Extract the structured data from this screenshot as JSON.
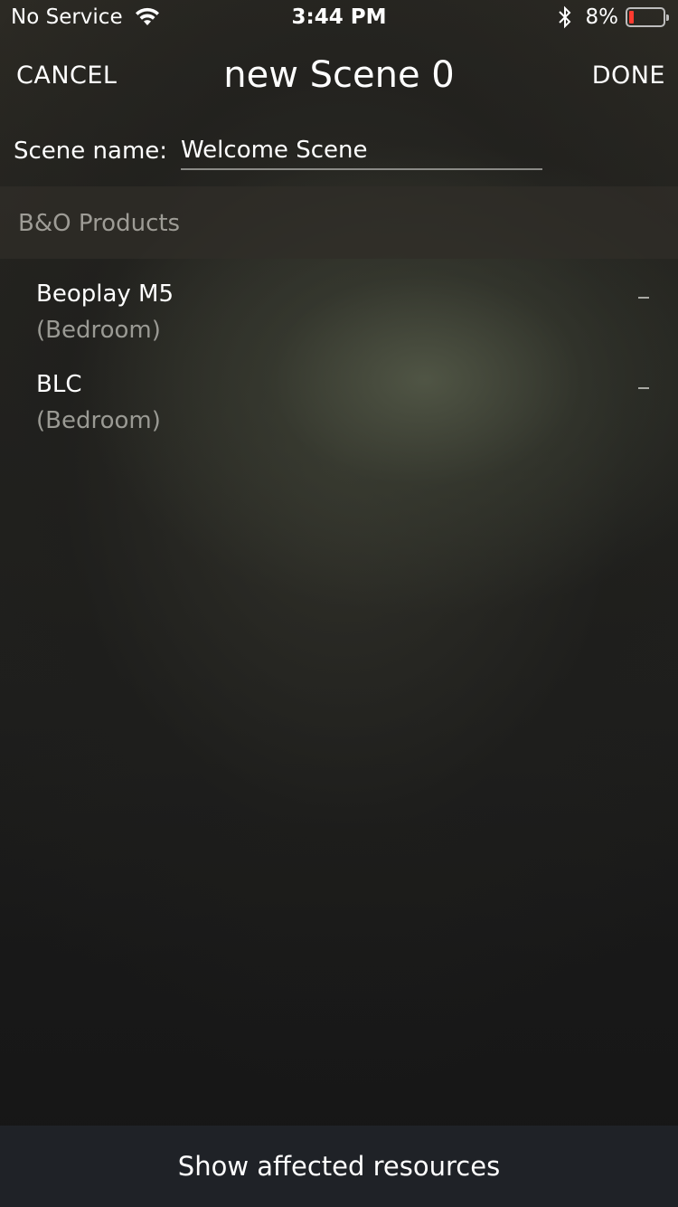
{
  "status_bar": {
    "carrier": "No Service",
    "time": "3:44 PM",
    "battery_percent": "8%",
    "battery_level": 0.08,
    "battery_color": "#ff3b30",
    "icons": [
      "wifi-icon",
      "bluetooth-icon",
      "battery-icon"
    ]
  },
  "nav": {
    "cancel_label": "CANCEL",
    "title": "new Scene 0",
    "done_label": "DONE"
  },
  "scene_name": {
    "label": "Scene name:",
    "value": "Welcome Scene"
  },
  "section": {
    "title": "B&O Products"
  },
  "products": [
    {
      "name": "Beoplay M5",
      "room": "(Bedroom)",
      "action_icon": "minus-icon"
    },
    {
      "name": "BLC",
      "room": "(Bedroom)",
      "action_icon": "minus-icon"
    }
  ],
  "bottom": {
    "label": "Show affected resources"
  }
}
